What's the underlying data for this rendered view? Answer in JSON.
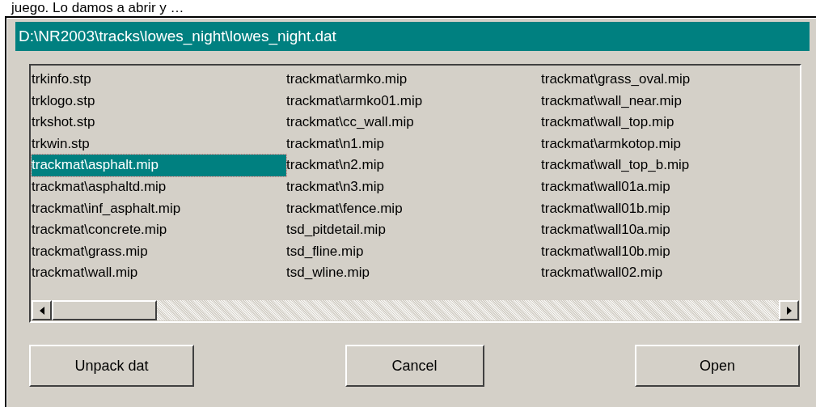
{
  "caption": "juego. Lo damos a abrir y …",
  "window": {
    "title": "D:\\NR2003\\tracks\\lowes_night\\lowes_night.dat"
  },
  "file_list": {
    "columns": [
      [
        {
          "text": "trkinfo.stp",
          "selected": false
        },
        {
          "text": "trklogo.stp",
          "selected": false
        },
        {
          "text": "trkshot.stp",
          "selected": false
        },
        {
          "text": "trkwin.stp",
          "selected": false
        },
        {
          "text": "trackmat\\asphalt.mip",
          "selected": true
        },
        {
          "text": "trackmat\\asphaltd.mip",
          "selected": false
        },
        {
          "text": "trackmat\\inf_asphalt.mip",
          "selected": false
        },
        {
          "text": "trackmat\\concrete.mip",
          "selected": false
        },
        {
          "text": "trackmat\\grass.mip",
          "selected": false
        },
        {
          "text": "trackmat\\wall.mip",
          "selected": false
        }
      ],
      [
        {
          "text": "trackmat\\armko.mip",
          "selected": false
        },
        {
          "text": "trackmat\\armko01.mip",
          "selected": false
        },
        {
          "text": "trackmat\\cc_wall.mip",
          "selected": false
        },
        {
          "text": "trackmat\\n1.mip",
          "selected": false
        },
        {
          "text": "trackmat\\n2.mip",
          "selected": false
        },
        {
          "text": "trackmat\\n3.mip",
          "selected": false
        },
        {
          "text": "trackmat\\fence.mip",
          "selected": false
        },
        {
          "text": "tsd_pitdetail.mip",
          "selected": false
        },
        {
          "text": "tsd_fline.mip",
          "selected": false
        },
        {
          "text": "tsd_wline.mip",
          "selected": false
        }
      ],
      [
        {
          "text": "trackmat\\grass_oval.mip",
          "selected": false
        },
        {
          "text": "trackmat\\wall_near.mip",
          "selected": false
        },
        {
          "text": "trackmat\\wall_top.mip",
          "selected": false
        },
        {
          "text": "trackmat\\armkotop.mip",
          "selected": false
        },
        {
          "text": "trackmat\\wall_top_b.mip",
          "selected": false
        },
        {
          "text": "trackmat\\wall01a.mip",
          "selected": false
        },
        {
          "text": "trackmat\\wall01b.mip",
          "selected": false
        },
        {
          "text": "trackmat\\wall10a.mip",
          "selected": false
        },
        {
          "text": "trackmat\\wall10b.mip",
          "selected": false
        },
        {
          "text": "trackmat\\wall02.mip",
          "selected": false
        }
      ]
    ]
  },
  "buttons": [
    "Unpack dat",
    "Cancel",
    "Open"
  ]
}
